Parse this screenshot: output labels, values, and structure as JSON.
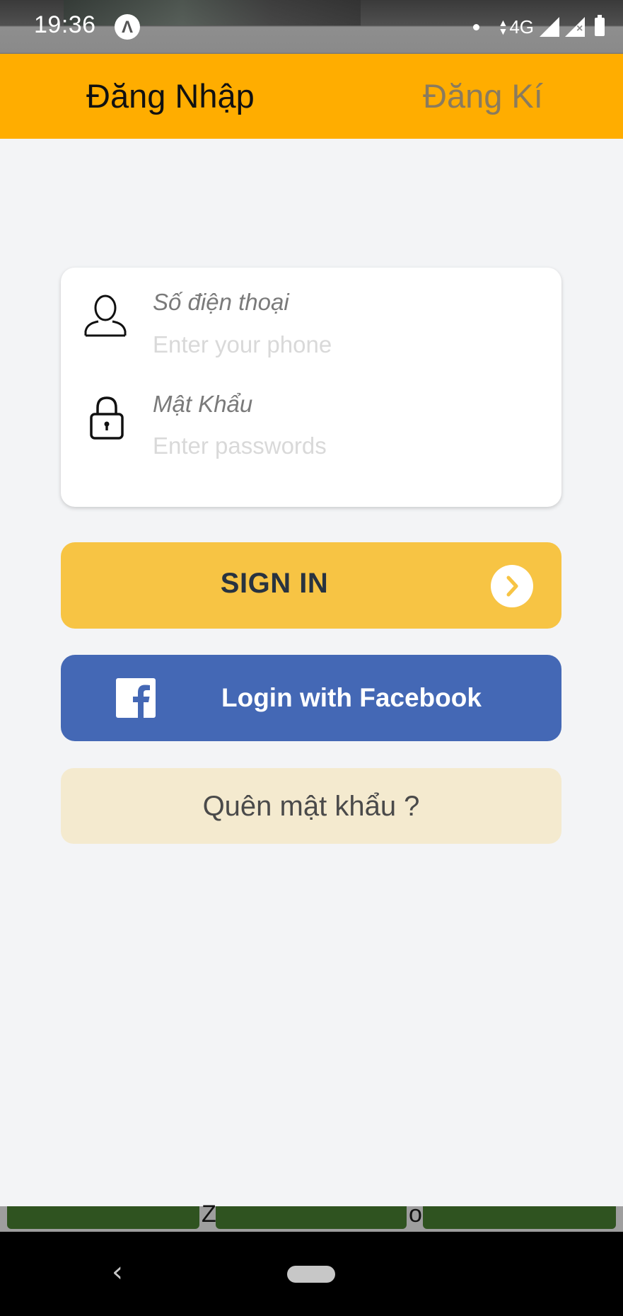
{
  "status_bar": {
    "time": "19:36",
    "network": "4G",
    "app_icon_glyph": "Λ"
  },
  "tabs": {
    "login": "Đăng Nhập",
    "register": "Đăng Kí"
  },
  "form": {
    "phone": {
      "label": "Số điện thoại",
      "placeholder": "Enter your phone"
    },
    "password": {
      "label": "Mật Khẩu",
      "placeholder": "Enter passwords"
    }
  },
  "buttons": {
    "sign_in": "SIGN IN",
    "facebook": "Login with Facebook",
    "forgot": "Quên mật khẩu ?"
  },
  "bottom_strip": {
    "glyph_1": "Z",
    "glyph_2": "o"
  },
  "nav": {
    "back_glyph": "‹"
  },
  "colors": {
    "header": "#ffad00",
    "sign_in": "#f7c444",
    "facebook": "#4468b5",
    "forgot": "#f4eacf"
  }
}
